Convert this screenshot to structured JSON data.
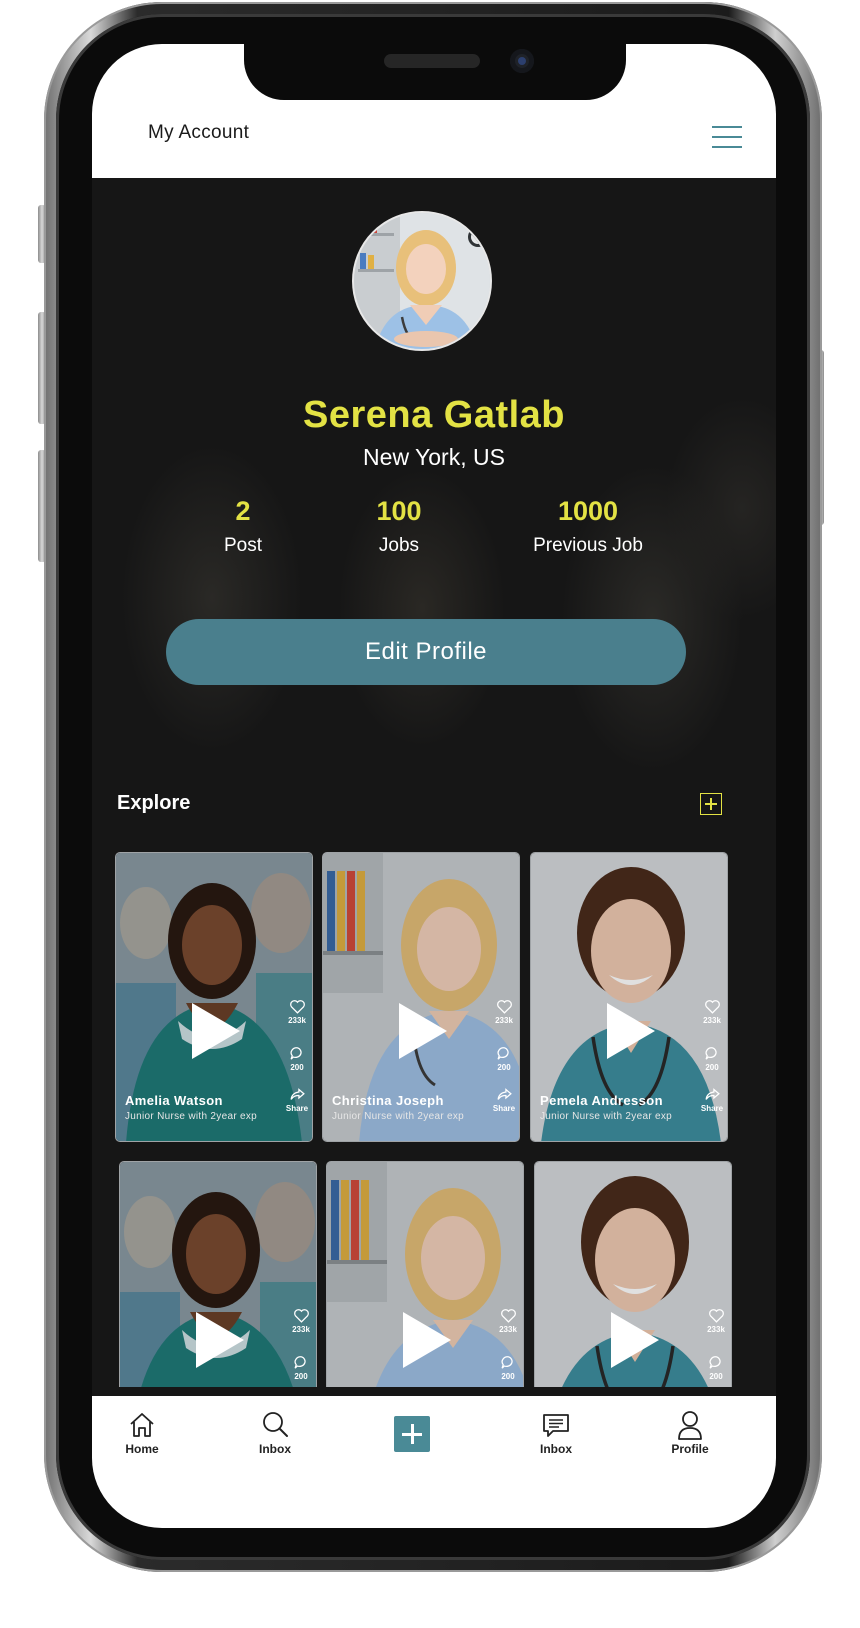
{
  "header": {
    "title": "My Account",
    "menu_icon": "hamburger-menu-icon"
  },
  "profile": {
    "name": "Serena Gatlab",
    "location": "New York, US",
    "stats": [
      {
        "value": "2",
        "label": "Post"
      },
      {
        "value": "100",
        "label": "Jobs"
      },
      {
        "value": "1000",
        "label": "Previous Job"
      }
    ],
    "edit_button": "Edit Profile"
  },
  "explore": {
    "title": "Explore",
    "add_icon": "plus-square-icon",
    "cards": [
      {
        "name": "Amelia Watson",
        "subtitle": "Junior Nurse with 2year exp",
        "likes": "233k",
        "comments": "200",
        "share": "Share"
      },
      {
        "name": "Christina Joseph",
        "subtitle": "Junior Nurse with 2year exp",
        "likes": "233k",
        "comments": "200",
        "share": "Share"
      },
      {
        "name": "Pemela Andresson",
        "subtitle": "Junior Nurse with 2year exp",
        "likes": "233k",
        "comments": "200",
        "share": "Share"
      },
      {
        "likes": "233k",
        "comments": "200"
      },
      {
        "likes": "233k",
        "comments": "200"
      },
      {
        "likes": "233k",
        "comments": "200"
      }
    ]
  },
  "bottom_nav": {
    "items": [
      {
        "label": "Home",
        "icon": "home-icon"
      },
      {
        "label": "Inbox",
        "icon": "search-icon"
      },
      {
        "label": "",
        "icon": "add-icon"
      },
      {
        "label": "Inbox",
        "icon": "message-icon"
      },
      {
        "label": "Profile",
        "icon": "user-icon"
      }
    ]
  },
  "colors": {
    "accent_yellow": "#e3e244",
    "teal": "#4a7f8d",
    "background_dark": "#161616"
  }
}
